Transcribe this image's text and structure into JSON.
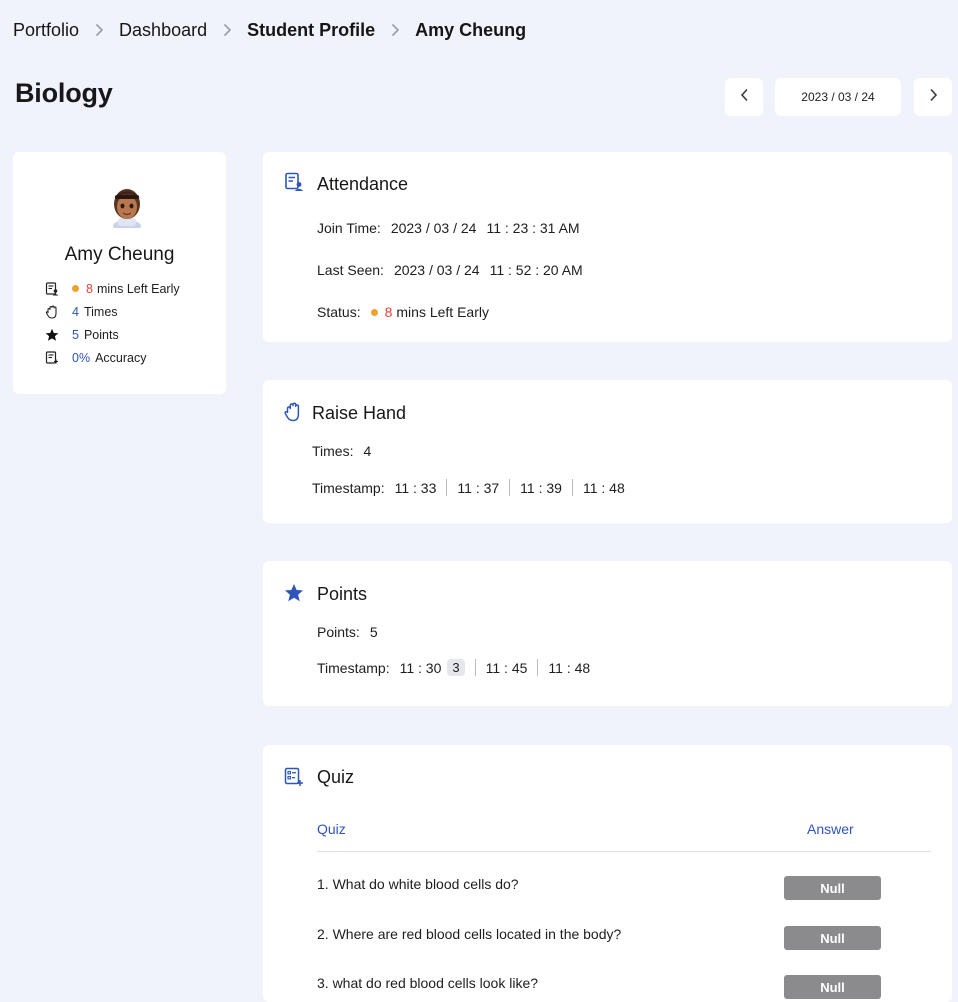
{
  "breadcrumb": [
    "Portfolio",
    "Dashboard",
    "Student Profile",
    "Amy Cheung"
  ],
  "page_title": "Biology",
  "date_nav": {
    "date": "2023 / 03 / 24"
  },
  "profile": {
    "name": "Amy Cheung",
    "left_early_minutes": "8",
    "left_early_text": "mins Left Early",
    "raise_count": "4",
    "raise_text": "Times",
    "points": "5",
    "points_text": "Points",
    "accuracy": "0%",
    "accuracy_text": "Accuracy"
  },
  "attendance": {
    "title": "Attendance",
    "join_label": "Join Time:",
    "join_date": "2023 / 03 / 24",
    "join_time": "11 : 23 : 31 AM",
    "last_label": "Last Seen:",
    "last_date": "2023 / 03 / 24",
    "last_time": "11 : 52 : 20 AM",
    "status_label": "Status:",
    "status_minutes": "8",
    "status_text": "mins Left Early"
  },
  "raise_hand": {
    "title": "Raise Hand",
    "times_label": "Times:",
    "times_value": "4",
    "timestamp_label": "Timestamp:",
    "timestamps": [
      "11 : 33",
      "11 : 37",
      "11 : 39",
      "11 : 48"
    ]
  },
  "points": {
    "title": "Points",
    "points_label": "Points:",
    "points_value": "5",
    "timestamp_label": "Timestamp:",
    "timestamps": [
      "11 : 30",
      "11 : 45",
      "11 : 48"
    ],
    "first_badge": "3"
  },
  "quiz": {
    "title": "Quiz",
    "col_quiz": "Quiz",
    "col_answer": "Answer",
    "questions": [
      {
        "text": "1. What do white blood cells do?",
        "answer": "Null"
      },
      {
        "text": "2. Where are red blood cells located in the body?",
        "answer": "Null"
      },
      {
        "text": "3. what do red blood cells look like?",
        "answer": "Null"
      }
    ]
  },
  "colors": {
    "accent_blue": "#2e55b8",
    "status_orange": "#f0a030",
    "alert_red": "#e0453a",
    "badge_gray": "#8b8b8d",
    "background": "#f0f3fb"
  },
  "icons": {
    "breadcrumb_separator": "chevron-right-icon",
    "prev": "chevron-left-icon",
    "next": "chevron-right-icon",
    "attendance": "attendance-icon",
    "raise_hand": "hand-icon",
    "points": "star-icon",
    "quiz": "quiz-icon",
    "accuracy": "accuracy-icon"
  }
}
